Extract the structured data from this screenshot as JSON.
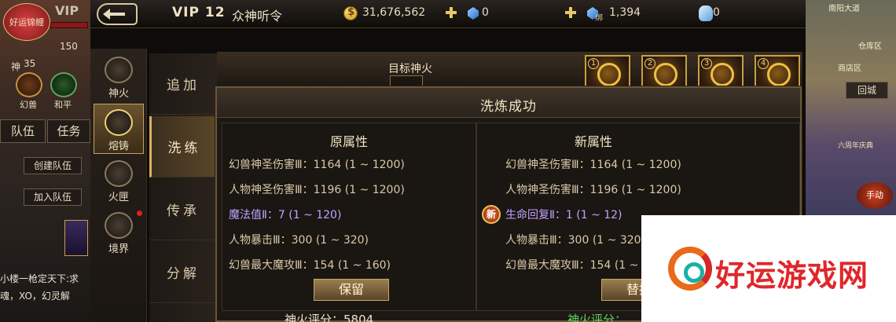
{
  "topbar": {
    "vip": "VIP 12",
    "title": "众神听令",
    "gold": "31,676,562",
    "diamond": "0",
    "bind_tag": "绑",
    "bound_diamond": "1,394",
    "ice": "0"
  },
  "left_hud": {
    "guild_banner": "好运锦鲤",
    "vip_small": "VIP",
    "power": "150",
    "level_label": "神",
    "level": "35",
    "mode_illusion": "幻兽",
    "mode_peace": "和平",
    "tab_team": "队伍",
    "tab_task": "任务",
    "create_team": "创建队伍",
    "join_team": "加入队伍",
    "chat1": "小楼一枪定天下:求",
    "chat2": "魂，XO，幻灵解"
  },
  "side_tabs": [
    {
      "label": "神火",
      "icon": "divine-fire-icon"
    },
    {
      "label": "熔铸",
      "icon": "forge-icon"
    },
    {
      "label": "火匣",
      "icon": "fire-box-icon"
    },
    {
      "label": "境界",
      "icon": "realm-icon"
    }
  ],
  "sub_tabs": [
    "追加",
    "洗练",
    "传承",
    "分解"
  ],
  "upper": {
    "target_label": "目标神火",
    "slots": [
      "1",
      "2",
      "3",
      "4"
    ]
  },
  "dialog": {
    "title": "洗炼成功",
    "old_header": "原属性",
    "new_header": "新属性",
    "old_attrs": [
      "幻兽神圣伤害Ⅲ：1164 (1 ~ 1200)",
      "人物神圣伤害Ⅲ：1196 (1 ~ 1200)",
      "魔法值Ⅱ：7 (1 ~ 120)",
      "人物暴击Ⅲ：300 (1 ~ 320)",
      "幻兽最大魔攻Ⅲ：154 (1 ~ 160)"
    ],
    "new_attrs": [
      "幻兽神圣伤害Ⅲ：1164 (1 ~ 1200)",
      "人物神圣伤害Ⅲ：1196 (1 ~ 1200)",
      "生命回复Ⅱ：1 (1 ~ 12)",
      "人物暴击Ⅲ：300 (1 ~ 320)",
      "幻兽最大魔攻Ⅲ：154 (1 ~ 160)"
    ],
    "new_badge": "新",
    "keep_button": "保留",
    "replace_button": "替换",
    "old_score": "神火评分：5804",
    "new_score": "神火评分："
  },
  "right_hud": {
    "map_label1": "南阳大道",
    "map_label2": "仓库区",
    "map_label3": "商店区",
    "return_city": "回城",
    "event_text": "六周年庆典",
    "auto": "手动"
  },
  "watermark": {
    "text": "好运游戏网"
  },
  "colors": {
    "purple_attr": "#c3a2ff",
    "green_score": "#5ed05e",
    "gold_frame": "#c8a040"
  }
}
